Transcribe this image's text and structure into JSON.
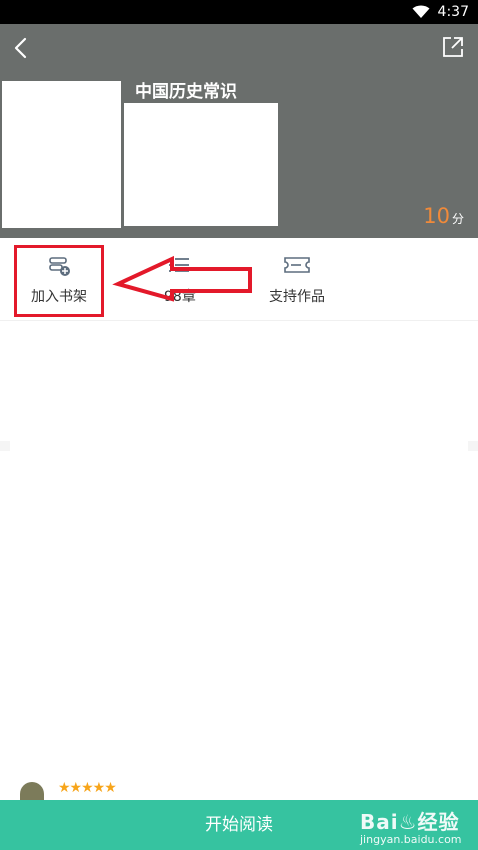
{
  "status_bar": {
    "time": "4:37"
  },
  "header": {
    "book_title": "中国历史常识",
    "score_value": "10",
    "score_unit": "分"
  },
  "actions": {
    "add_shelf": "加入书架",
    "chapters": "98章",
    "support": "支持作品"
  },
  "review": {
    "stars": "★★★★★"
  },
  "bottom": {
    "start_read": "开始阅读"
  },
  "watermark": {
    "main": "Bai♨经验",
    "sub": "jingyan.baidu.com"
  },
  "colors": {
    "header_bg": "#6a6e6c",
    "accent_green": "#36c3a0",
    "score_orange": "#f08a3a",
    "annotation_red": "#e3192a",
    "star_color": "#f7a51b"
  },
  "icons": [
    "back-arrow-icon",
    "share-icon",
    "bookshelf-add-icon",
    "chapter-list-icon",
    "ticket-icon",
    "wifi-icon"
  ]
}
